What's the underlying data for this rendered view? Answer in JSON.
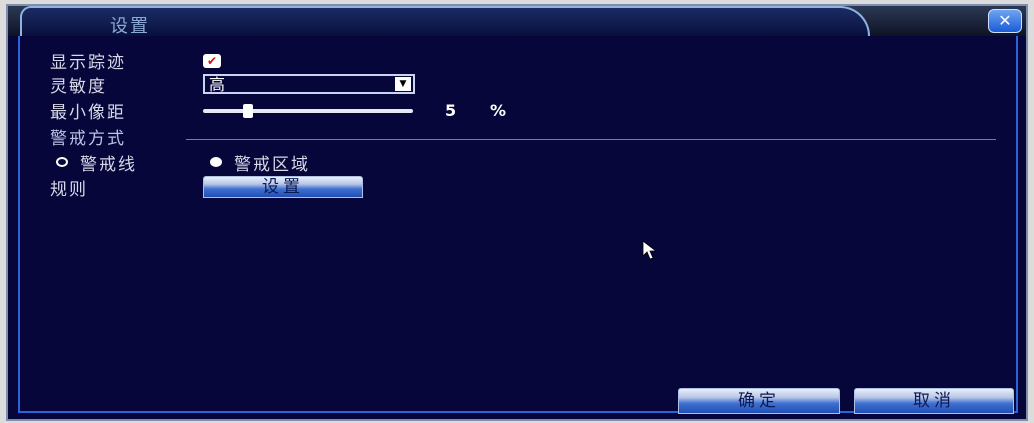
{
  "window": {
    "title": "设置",
    "close_icon": "close-x-icon"
  },
  "form": {
    "show_trace": {
      "label": "显示踪迹",
      "checked": true
    },
    "sensitivity": {
      "label": "灵敏度",
      "value": "高"
    },
    "min_pixel_distance": {
      "label": "最小像距",
      "value": "5",
      "unit": "%",
      "fraction": 0.2
    },
    "alert_mode": {
      "heading": "警戒方式",
      "options": [
        {
          "label": "警戒线",
          "selected": false
        },
        {
          "label": "警戒区域",
          "selected": true
        }
      ]
    },
    "rule": {
      "label": "规则",
      "button_label": "设置"
    }
  },
  "footer": {
    "ok_label": "确定",
    "cancel_label": "取消"
  },
  "colors": {
    "background": "#06063a",
    "border": "#2b63d8",
    "text": "#d8d8e8"
  }
}
